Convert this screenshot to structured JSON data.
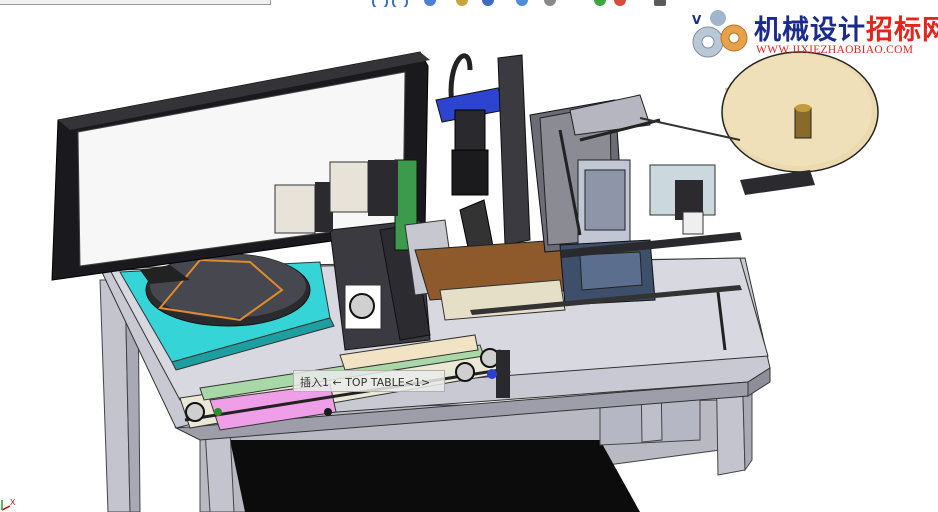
{
  "watermark": {
    "title_part1": "机械设计",
    "title_part2": "招标网",
    "url": "WWW.JIXIEZHAOBIAO.COM"
  },
  "tooltip": {
    "text": "插入1 ← TOP TABLE<1>"
  },
  "triad": {
    "x_label": "X"
  },
  "colors": {
    "background": "#ffffff",
    "watermark_blue": "#1b2b8c",
    "watermark_red": "#e5241c",
    "table_cyan": "#33d6d8",
    "machine_frame": "#c9c9d4",
    "reel": "#ecd9ad",
    "pink_part": "#ec9fe8"
  },
  "icons": [
    "zoom-to-fit-icon",
    "zoom-area-icon",
    "previous-view-icon",
    "section-view-icon",
    "view-orientation-icon",
    "display-style-icon",
    "hide-show-icon",
    "appearance-icon",
    "scene-icon",
    "view-settings-icon"
  ]
}
